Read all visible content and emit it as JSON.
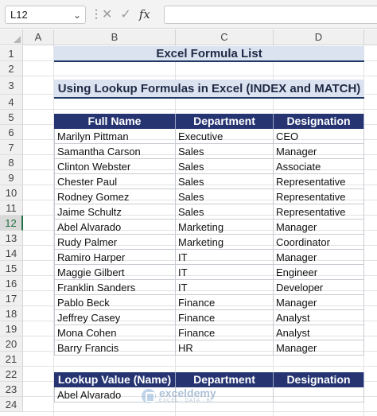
{
  "formula_bar": {
    "name_box": "L12",
    "fx_label": "fx",
    "formula": ""
  },
  "columns": [
    "A",
    "B",
    "C",
    "D"
  ],
  "rows": [
    "1",
    "2",
    "3",
    "4",
    "5",
    "6",
    "7",
    "8",
    "9",
    "10",
    "11",
    "12",
    "13",
    "14",
    "15",
    "16",
    "17",
    "18",
    "19",
    "20",
    "21",
    "22",
    "23",
    "24"
  ],
  "selected_row": "12",
  "sheet": {
    "title": "Excel Formula List",
    "subtitle": "Using Lookup Formulas in Excel (INDEX and MATCH)",
    "headers": [
      "Full Name",
      "Department",
      "Designation"
    ],
    "table": [
      [
        "Marilyn Pittman",
        "Executive",
        "CEO"
      ],
      [
        "Samantha Carson",
        "Sales",
        "Manager"
      ],
      [
        "Clinton Webster",
        "Sales",
        "Associate"
      ],
      [
        "Chester Paul",
        "Sales",
        "Representative"
      ],
      [
        "Rodney Gomez",
        "Sales",
        "Representative"
      ],
      [
        "Jaime Schultz",
        "Sales",
        "Representative"
      ],
      [
        "Abel Alvarado",
        "Marketing",
        "Manager"
      ],
      [
        "Rudy Palmer",
        "Marketing",
        "Coordinator"
      ],
      [
        "Ramiro Harper",
        "IT",
        "Manager"
      ],
      [
        "Maggie Gilbert",
        "IT",
        "Engineer"
      ],
      [
        "Franklin Sanders",
        "IT",
        "Developer"
      ],
      [
        "Pablo Beck",
        "Finance",
        "Manager"
      ],
      [
        "Jeffrey Casey",
        "Finance",
        "Analyst"
      ],
      [
        "Mona Cohen",
        "Finance",
        "Analyst"
      ],
      [
        "Barry Francis",
        "HR",
        "Manager"
      ]
    ],
    "lookup_headers": [
      "Lookup Value (Name)",
      "Department",
      "Designation"
    ],
    "lookup_row": [
      "Abel Alvarado",
      "",
      ""
    ]
  },
  "watermark": {
    "name": "exceldemy",
    "tagline": "EXCEL · DATA · BI"
  },
  "colors": {
    "header_fill": "#263572",
    "title_fill": "#dbe3f1",
    "selection_green": "#217346"
  }
}
